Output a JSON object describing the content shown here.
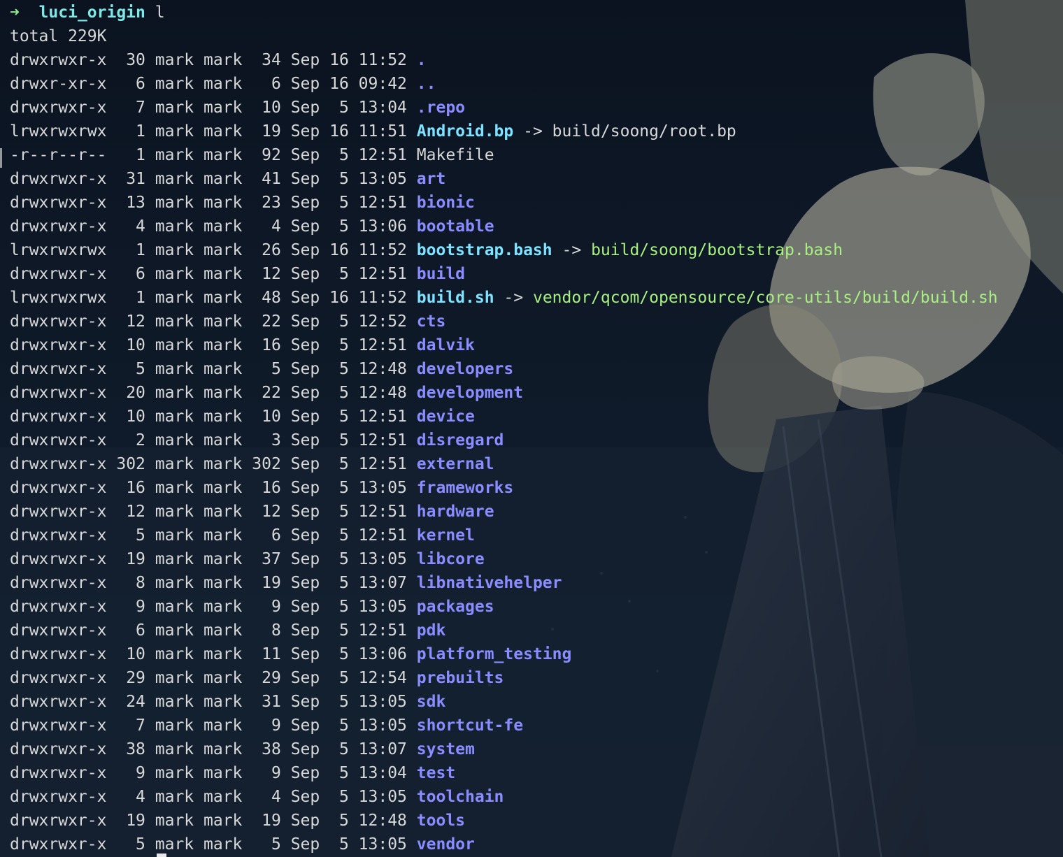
{
  "prompt": {
    "arrow": "➜",
    "directory": "luci_origin",
    "command": "l"
  },
  "total_line": "total 229K",
  "entries": [
    {
      "perms": "drwxrwxr-x",
      "links": "30",
      "owner": "mark",
      "group": "mark",
      "size": "34",
      "month": "Sep",
      "day": "16",
      "time": "11:52",
      "name": ".",
      "kind": "dir"
    },
    {
      "perms": "drwxr-xr-x",
      "links": "6",
      "owner": "mark",
      "group": "mark",
      "size": "6",
      "month": "Sep",
      "day": "16",
      "time": "09:42",
      "name": "..",
      "kind": "dir"
    },
    {
      "perms": "drwxrwxr-x",
      "links": "7",
      "owner": "mark",
      "group": "mark",
      "size": "10",
      "month": "Sep",
      "day": "5",
      "time": "13:04",
      "name": ".repo",
      "kind": "dir"
    },
    {
      "perms": "lrwxrwxrwx",
      "links": "1",
      "owner": "mark",
      "group": "mark",
      "size": "19",
      "month": "Sep",
      "day": "16",
      "time": "11:51",
      "name": "Android.bp",
      "kind": "link",
      "target": "build/soong/root.bp",
      "target_kind": "file"
    },
    {
      "perms": "-r--r--r--",
      "links": "1",
      "owner": "mark",
      "group": "mark",
      "size": "92",
      "month": "Sep",
      "day": "5",
      "time": "12:51",
      "name": "Makefile",
      "kind": "file"
    },
    {
      "perms": "drwxrwxr-x",
      "links": "31",
      "owner": "mark",
      "group": "mark",
      "size": "41",
      "month": "Sep",
      "day": "5",
      "time": "13:05",
      "name": "art",
      "kind": "dir"
    },
    {
      "perms": "drwxrwxr-x",
      "links": "13",
      "owner": "mark",
      "group": "mark",
      "size": "23",
      "month": "Sep",
      "day": "5",
      "time": "12:51",
      "name": "bionic",
      "kind": "dir"
    },
    {
      "perms": "drwxrwxr-x",
      "links": "4",
      "owner": "mark",
      "group": "mark",
      "size": "4",
      "month": "Sep",
      "day": "5",
      "time": "13:06",
      "name": "bootable",
      "kind": "dir"
    },
    {
      "perms": "lrwxrwxrwx",
      "links": "1",
      "owner": "mark",
      "group": "mark",
      "size": "26",
      "month": "Sep",
      "day": "16",
      "time": "11:52",
      "name": "bootstrap.bash",
      "kind": "link",
      "target": "build/soong/bootstrap.bash",
      "target_kind": "exec"
    },
    {
      "perms": "drwxrwxr-x",
      "links": "6",
      "owner": "mark",
      "group": "mark",
      "size": "12",
      "month": "Sep",
      "day": "5",
      "time": "12:51",
      "name": "build",
      "kind": "dir"
    },
    {
      "perms": "lrwxrwxrwx",
      "links": "1",
      "owner": "mark",
      "group": "mark",
      "size": "48",
      "month": "Sep",
      "day": "16",
      "time": "11:52",
      "name": "build.sh",
      "kind": "link",
      "target": "vendor/qcom/opensource/core-utils/build/build.sh",
      "target_kind": "exec"
    },
    {
      "perms": "drwxrwxr-x",
      "links": "12",
      "owner": "mark",
      "group": "mark",
      "size": "22",
      "month": "Sep",
      "day": "5",
      "time": "12:52",
      "name": "cts",
      "kind": "dir"
    },
    {
      "perms": "drwxrwxr-x",
      "links": "10",
      "owner": "mark",
      "group": "mark",
      "size": "16",
      "month": "Sep",
      "day": "5",
      "time": "12:51",
      "name": "dalvik",
      "kind": "dir"
    },
    {
      "perms": "drwxrwxr-x",
      "links": "5",
      "owner": "mark",
      "group": "mark",
      "size": "5",
      "month": "Sep",
      "day": "5",
      "time": "12:48",
      "name": "developers",
      "kind": "dir"
    },
    {
      "perms": "drwxrwxr-x",
      "links": "20",
      "owner": "mark",
      "group": "mark",
      "size": "22",
      "month": "Sep",
      "day": "5",
      "time": "12:48",
      "name": "development",
      "kind": "dir"
    },
    {
      "perms": "drwxrwxr-x",
      "links": "10",
      "owner": "mark",
      "group": "mark",
      "size": "10",
      "month": "Sep",
      "day": "5",
      "time": "12:51",
      "name": "device",
      "kind": "dir"
    },
    {
      "perms": "drwxrwxr-x",
      "links": "2",
      "owner": "mark",
      "group": "mark",
      "size": "3",
      "month": "Sep",
      "day": "5",
      "time": "12:51",
      "name": "disregard",
      "kind": "dir"
    },
    {
      "perms": "drwxrwxr-x",
      "links": "302",
      "owner": "mark",
      "group": "mark",
      "size": "302",
      "month": "Sep",
      "day": "5",
      "time": "12:51",
      "name": "external",
      "kind": "dir"
    },
    {
      "perms": "drwxrwxr-x",
      "links": "16",
      "owner": "mark",
      "group": "mark",
      "size": "16",
      "month": "Sep",
      "day": "5",
      "time": "13:05",
      "name": "frameworks",
      "kind": "dir"
    },
    {
      "perms": "drwxrwxr-x",
      "links": "12",
      "owner": "mark",
      "group": "mark",
      "size": "12",
      "month": "Sep",
      "day": "5",
      "time": "12:51",
      "name": "hardware",
      "kind": "dir"
    },
    {
      "perms": "drwxrwxr-x",
      "links": "5",
      "owner": "mark",
      "group": "mark",
      "size": "6",
      "month": "Sep",
      "day": "5",
      "time": "12:51",
      "name": "kernel",
      "kind": "dir"
    },
    {
      "perms": "drwxrwxr-x",
      "links": "19",
      "owner": "mark",
      "group": "mark",
      "size": "37",
      "month": "Sep",
      "day": "5",
      "time": "13:05",
      "name": "libcore",
      "kind": "dir"
    },
    {
      "perms": "drwxrwxr-x",
      "links": "8",
      "owner": "mark",
      "group": "mark",
      "size": "19",
      "month": "Sep",
      "day": "5",
      "time": "13:07",
      "name": "libnativehelper",
      "kind": "dir"
    },
    {
      "perms": "drwxrwxr-x",
      "links": "9",
      "owner": "mark",
      "group": "mark",
      "size": "9",
      "month": "Sep",
      "day": "5",
      "time": "13:05",
      "name": "packages",
      "kind": "dir"
    },
    {
      "perms": "drwxrwxr-x",
      "links": "6",
      "owner": "mark",
      "group": "mark",
      "size": "8",
      "month": "Sep",
      "day": "5",
      "time": "12:51",
      "name": "pdk",
      "kind": "dir"
    },
    {
      "perms": "drwxrwxr-x",
      "links": "10",
      "owner": "mark",
      "group": "mark",
      "size": "11",
      "month": "Sep",
      "day": "5",
      "time": "13:06",
      "name": "platform_testing",
      "kind": "dir"
    },
    {
      "perms": "drwxrwxr-x",
      "links": "29",
      "owner": "mark",
      "group": "mark",
      "size": "29",
      "month": "Sep",
      "day": "5",
      "time": "12:54",
      "name": "prebuilts",
      "kind": "dir"
    },
    {
      "perms": "drwxrwxr-x",
      "links": "24",
      "owner": "mark",
      "group": "mark",
      "size": "31",
      "month": "Sep",
      "day": "5",
      "time": "13:05",
      "name": "sdk",
      "kind": "dir"
    },
    {
      "perms": "drwxrwxr-x",
      "links": "7",
      "owner": "mark",
      "group": "mark",
      "size": "9",
      "month": "Sep",
      "day": "5",
      "time": "13:05",
      "name": "shortcut-fe",
      "kind": "dir"
    },
    {
      "perms": "drwxrwxr-x",
      "links": "38",
      "owner": "mark",
      "group": "mark",
      "size": "38",
      "month": "Sep",
      "day": "5",
      "time": "13:07",
      "name": "system",
      "kind": "dir"
    },
    {
      "perms": "drwxrwxr-x",
      "links": "9",
      "owner": "mark",
      "group": "mark",
      "size": "9",
      "month": "Sep",
      "day": "5",
      "time": "13:04",
      "name": "test",
      "kind": "dir"
    },
    {
      "perms": "drwxrwxr-x",
      "links": "4",
      "owner": "mark",
      "group": "mark",
      "size": "4",
      "month": "Sep",
      "day": "5",
      "time": "13:05",
      "name": "toolchain",
      "kind": "dir"
    },
    {
      "perms": "drwxrwxr-x",
      "links": "19",
      "owner": "mark",
      "group": "mark",
      "size": "19",
      "month": "Sep",
      "day": "5",
      "time": "12:48",
      "name": "tools",
      "kind": "dir"
    },
    {
      "perms": "drwxrwxr-x",
      "links": "5",
      "owner": "mark",
      "group": "mark",
      "size": "5",
      "month": "Sep",
      "day": "5",
      "time": "13:05",
      "name": "vendor",
      "kind": "dir"
    }
  ],
  "colors": {
    "background": "#0d1724",
    "text": "#d8d8d8",
    "directory": "#8b8cff",
    "symlink": "#7fe3ff",
    "exec_target": "#a8f080",
    "prompt_arrow": "#8ee88a",
    "prompt_dir": "#7fe8e6"
  }
}
